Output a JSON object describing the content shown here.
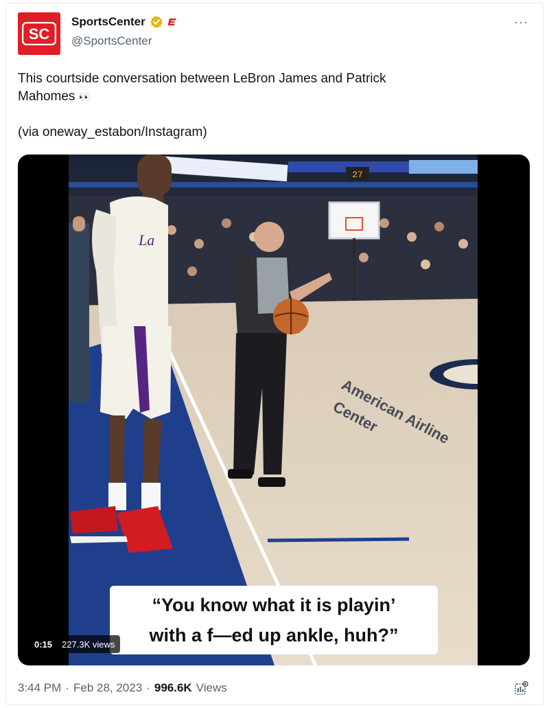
{
  "tweet": {
    "avatar_text": "SC",
    "display_name": "SportsCenter",
    "handle": "@SportsCenter",
    "more_label": "···",
    "text_line1": "This courtside conversation between LeBron James and Patrick",
    "text_line2": "Mahomes",
    "eyes_emoji": "👀",
    "via": "(via oneway_estabon/Instagram)"
  },
  "video": {
    "caption_line1": "“You know what it is playin’",
    "caption_line2": "with a f—ed up ankle, huh?”",
    "elapsed": "0:15",
    "views": "227.3K views",
    "scoreboard_digits": "27",
    "court_text_line1": "American Airline",
    "court_text_line2": "Center"
  },
  "footer": {
    "time": "3:44 PM",
    "dot1": "·",
    "date": "Feb 28, 2023",
    "dot2": "·",
    "view_count": "996.6K",
    "views_label": "Views"
  },
  "colors": {
    "brand_red": "#e31d25",
    "verified_gold": "#e2b719",
    "muted": "#536471"
  }
}
